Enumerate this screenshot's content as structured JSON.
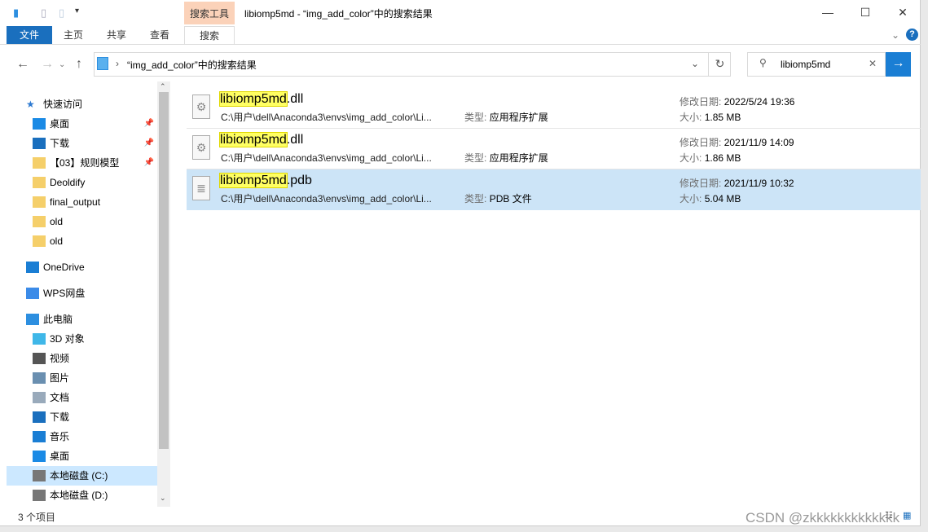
{
  "window": {
    "title": "libiomp5md - “img_add_color”中的搜索结果",
    "context_tab": "搜索工具",
    "minimize": "—",
    "maximize": "☐",
    "close": "✕"
  },
  "ribbon": {
    "tabs": [
      "文件",
      "主页",
      "共享",
      "查看",
      "搜索"
    ],
    "selected": "搜索",
    "help": "?"
  },
  "address": {
    "path": "“img_add_color”中的搜索结果",
    "refresh": "↻"
  },
  "search": {
    "value": "libiomp5md",
    "clear": "✕",
    "go": "→"
  },
  "sidebar": {
    "items": [
      {
        "label": "快速访问",
        "icon": "star-icon",
        "color": "#2e7ad1"
      },
      {
        "label": "桌面",
        "icon": "desktop-icon",
        "pinned": true,
        "color": "#1a8ae5"
      },
      {
        "label": "下载",
        "icon": "download-icon",
        "pinned": true,
        "color": "#1a6fbe"
      },
      {
        "label": "【03】规则模型",
        "icon": "folder-icon",
        "pinned": true,
        "color": "#f5cf6a"
      },
      {
        "label": "Deoldify",
        "icon": "folder-icon",
        "color": "#f5cf6a"
      },
      {
        "label": "final_output",
        "icon": "folder-icon",
        "color": "#f5cf6a"
      },
      {
        "label": "old",
        "icon": "folder-icon",
        "color": "#f5cf6a"
      },
      {
        "label": "old",
        "icon": "folder-icon",
        "color": "#f5cf6a"
      },
      {
        "label": "OneDrive",
        "icon": "cloud-icon",
        "color": "#1a7ed4"
      },
      {
        "label": "WPS网盘",
        "icon": "cloud-icon",
        "color": "#3b8be8"
      },
      {
        "label": "此电脑",
        "icon": "computer-icon",
        "color": "#2d8fe0"
      },
      {
        "label": "3D 对象",
        "icon": "cube-icon",
        "color": "#3fb7e8"
      },
      {
        "label": "视频",
        "icon": "video-icon",
        "color": "#555"
      },
      {
        "label": "图片",
        "icon": "picture-icon",
        "color": "#6a8fb0"
      },
      {
        "label": "文档",
        "icon": "document-icon",
        "color": "#9ab"
      },
      {
        "label": "下载",
        "icon": "download-icon",
        "color": "#1a6fbe"
      },
      {
        "label": "音乐",
        "icon": "music-icon",
        "color": "#1a7ed4"
      },
      {
        "label": "桌面",
        "icon": "desktop-icon",
        "color": "#1a8ae5"
      },
      {
        "label": "本地磁盘 (C:)",
        "icon": "drive-icon",
        "selected": true,
        "color": "#777"
      },
      {
        "label": "本地磁盘 (D:)",
        "icon": "drive-icon",
        "color": "#777"
      }
    ]
  },
  "results": [
    {
      "match": "libiomp5md",
      "ext": ".dll",
      "path": "C:\\用户\\dell\\Anaconda3\\envs\\img_add_color\\Li...",
      "type_label": "类型:",
      "type": "应用程序扩展",
      "date_label": "修改日期:",
      "date": "2022/5/24 19:36",
      "size_label": "大小:",
      "size": "1.85 MB",
      "icon": "dll-gear-icon"
    },
    {
      "match": "libiomp5md",
      "ext": ".dll",
      "path": "C:\\用户\\dell\\Anaconda3\\envs\\img_add_color\\Li...",
      "type_label": "类型:",
      "type": "应用程序扩展",
      "date_label": "修改日期:",
      "date": "2021/11/9 14:09",
      "size_label": "大小:",
      "size": "1.86 MB",
      "icon": "dll-gear-icon"
    },
    {
      "match": "libiomp5md",
      "ext": ".pdb",
      "path": "C:\\用户\\dell\\Anaconda3\\envs\\img_add_color\\Li...",
      "type_label": "类型:",
      "type": "PDB 文件",
      "date_label": "修改日期:",
      "date": "2021/11/9 10:32",
      "size_label": "大小:",
      "size": "5.04 MB",
      "icon": "pdb-file-icon",
      "selected": true
    }
  ],
  "status": {
    "count": "3 个项目"
  },
  "watermark": "CSDN @zkkkkkkkkkkkkk"
}
